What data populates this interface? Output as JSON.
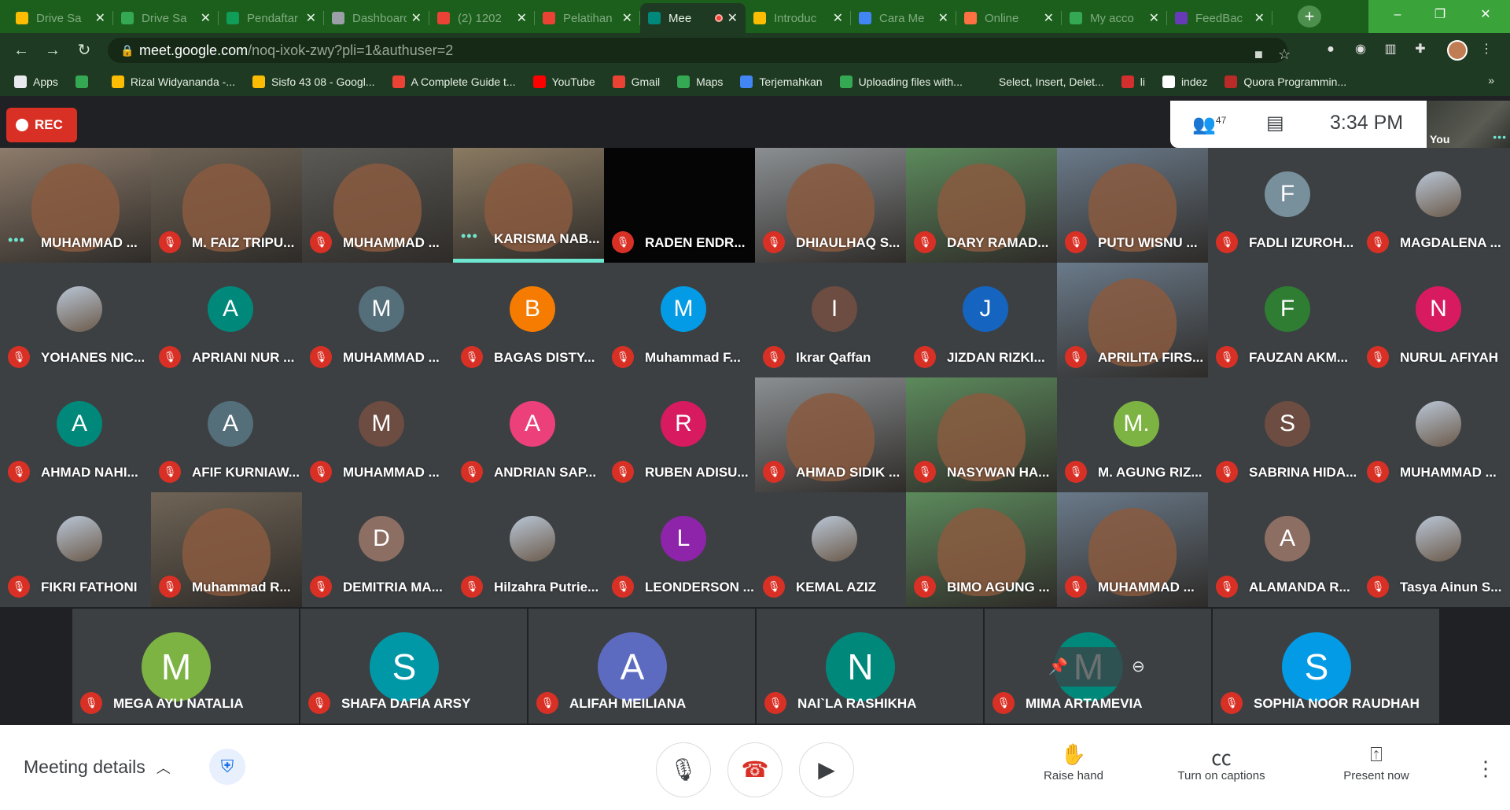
{
  "browser": {
    "tabs": [
      {
        "title": "Drive Sa",
        "favicon_color": "#fbbc04"
      },
      {
        "title": "Drive Sa",
        "favicon_color": "#34a853"
      },
      {
        "title": "Pendaftar",
        "favicon_color": "#0f9d58"
      },
      {
        "title": "Dashboard",
        "favicon_color": "#9aa0a6"
      },
      {
        "title": "(2) 1202",
        "favicon_color": "#ea4335"
      },
      {
        "title": "Pelatihan",
        "favicon_color": "#ea4335"
      },
      {
        "title": "Mee",
        "favicon_color": "#00897b"
      },
      {
        "title": "Introduc",
        "favicon_color": "#fbbc04"
      },
      {
        "title": "Cara Me",
        "favicon_color": "#4285f4"
      },
      {
        "title": "Online",
        "favicon_color": "#ff7043"
      },
      {
        "title": "My acco",
        "favicon_color": "#34a853"
      },
      {
        "title": "FeedBac",
        "favicon_color": "#673ab7"
      }
    ],
    "url_host": "meet.google.com",
    "url_path": "/noq-ixok-zwy?pli=1&authuser=2",
    "bookmarks": [
      {
        "label": "Apps",
        "icon_color": "#e8eaed"
      },
      {
        "label": "",
        "icon_color": "#34a853"
      },
      {
        "label": "Rizal Widyananda -...",
        "icon_color": "#fbbc04"
      },
      {
        "label": "Sisfo 43 08 - Googl...",
        "icon_color": "#fbbc04"
      },
      {
        "label": "A Complete Guide t...",
        "icon_color": "#ea4335"
      },
      {
        "label": "YouTube",
        "icon_color": "#ff0000"
      },
      {
        "label": "Gmail",
        "icon_color": "#ea4335"
      },
      {
        "label": "Maps",
        "icon_color": "#34a853"
      },
      {
        "label": "Terjemahkan",
        "icon_color": "#4285f4"
      },
      {
        "label": "Uploading files with...",
        "icon_color": "#34a853"
      },
      {
        "label": "Select, Insert, Delet...",
        "icon_color": "#1f3a22"
      },
      {
        "label": "li",
        "icon_color": "#d32f2f"
      },
      {
        "label": "indez",
        "icon_color": "#ffffff"
      },
      {
        "label": "Quora Programmin...",
        "icon_color": "#b92b27"
      }
    ],
    "bookmarks_more": "»"
  },
  "meet": {
    "rec_label": "REC",
    "participant_count": "47",
    "time": "3:34 PM",
    "self_label": "You",
    "grid": [
      {
        "name": "MUHAMMAD ...",
        "type": "cam",
        "speaking": true
      },
      {
        "name": "M. FAIZ TRIPU...",
        "type": "cam"
      },
      {
        "name": "MUHAMMAD ...",
        "type": "cam"
      },
      {
        "name": "KARISMA NAB...",
        "type": "cam",
        "speaking": true,
        "highlight": true
      },
      {
        "name": "RADEN ENDR...",
        "type": "dark"
      },
      {
        "name": "DHIAULHAQ S...",
        "type": "cam"
      },
      {
        "name": "DARY RAMAD...",
        "type": "cam"
      },
      {
        "name": "PUTU WISNU ...",
        "type": "cam"
      },
      {
        "name": "FADLI IZUROH...",
        "type": "avatar",
        "letter": "F",
        "color": "#78909c"
      },
      {
        "name": "MAGDALENA ...",
        "type": "photo"
      },
      {
        "name": "YOHANES NIC...",
        "type": "photo"
      },
      {
        "name": "APRIANI NUR ...",
        "type": "avatar",
        "letter": "A",
        "color": "#00897b"
      },
      {
        "name": "MUHAMMAD ...",
        "type": "avatar",
        "letter": "M",
        "color": "#546e7a"
      },
      {
        "name": "BAGAS DISTY...",
        "type": "avatar",
        "letter": "B",
        "color": "#f57c00"
      },
      {
        "name": "Muhammad F...",
        "type": "avatar",
        "letter": "M",
        "color": "#039be5"
      },
      {
        "name": "Ikrar Qaffan",
        "type": "avatar",
        "letter": "I",
        "color": "#6d4c41"
      },
      {
        "name": "JIZDAN RIZKI...",
        "type": "avatar",
        "letter": "J",
        "color": "#1565c0"
      },
      {
        "name": "APRILITA FIRS...",
        "type": "cam"
      },
      {
        "name": "FAUZAN AKM...",
        "type": "avatar",
        "letter": "F",
        "color": "#2e7d32"
      },
      {
        "name": "NURUL AFIYAH",
        "type": "avatar",
        "letter": "N",
        "color": "#d81b60"
      },
      {
        "name": "AHMAD NAHI...",
        "type": "avatar",
        "letter": "A",
        "color": "#00897b"
      },
      {
        "name": "AFIF KURNIAW...",
        "type": "avatar",
        "letter": "A",
        "color": "#546e7a"
      },
      {
        "name": "MUHAMMAD ...",
        "type": "avatar",
        "letter": "M",
        "color": "#6d4c41"
      },
      {
        "name": "ANDRIAN SAP...",
        "type": "avatar",
        "letter": "A",
        "color": "#ec407a"
      },
      {
        "name": "RUBEN ADISU...",
        "type": "avatar",
        "letter": "R",
        "color": "#d81b60"
      },
      {
        "name": "AHMAD SIDIK ...",
        "type": "cam"
      },
      {
        "name": "NASYWAN HA...",
        "type": "cam"
      },
      {
        "name": "M. AGUNG RIZ...",
        "type": "avatar",
        "letter": "M.",
        "color": "#7cb342"
      },
      {
        "name": "SABRINA HIDA...",
        "type": "avatar",
        "letter": "S",
        "color": "#6d4c41"
      },
      {
        "name": "MUHAMMAD ...",
        "type": "photo"
      },
      {
        "name": "FIKRI FATHONI",
        "type": "photo"
      },
      {
        "name": "Muhammad R...",
        "type": "cam"
      },
      {
        "name": "DEMITRIA MA...",
        "type": "avatar",
        "letter": "D",
        "color": "#8d6e63"
      },
      {
        "name": "Hilzahra Putrie...",
        "type": "photo"
      },
      {
        "name": "LEONDERSON ...",
        "type": "avatar",
        "letter": "L",
        "color": "#8e24aa"
      },
      {
        "name": "KEMAL AZIZ",
        "type": "photo"
      },
      {
        "name": "BIMO AGUNG ...",
        "type": "cam"
      },
      {
        "name": "MUHAMMAD ...",
        "type": "cam"
      },
      {
        "name": "ALAMANDA R...",
        "type": "avatar",
        "letter": "A",
        "color": "#8d6e63"
      },
      {
        "name": "Tasya Ainun S...",
        "type": "photo"
      }
    ],
    "last_row": [
      {
        "name": "MEGA AYU NATALIA",
        "letter": "M",
        "color": "#7cb342"
      },
      {
        "name": "SHAFA DAFIA ARSY",
        "letter": "S",
        "color": "#0097a7"
      },
      {
        "name": "ALIFAH MEILIANA",
        "letter": "A",
        "color": "#5c6bc0"
      },
      {
        "name": "NAI`LA RASHIKHA",
        "letter": "N",
        "color": "#00897b"
      },
      {
        "name": "MIMA ARTAMEVIA",
        "letter": "M",
        "color": "#00897b"
      },
      {
        "name": "SOPHIA NOOR RAUDHAH",
        "letter": "S",
        "color": "#039be5"
      }
    ],
    "bottom": {
      "meeting_details": "Meeting details",
      "raise_hand": "Raise hand",
      "captions": "Turn on captions",
      "present": "Present now"
    }
  }
}
